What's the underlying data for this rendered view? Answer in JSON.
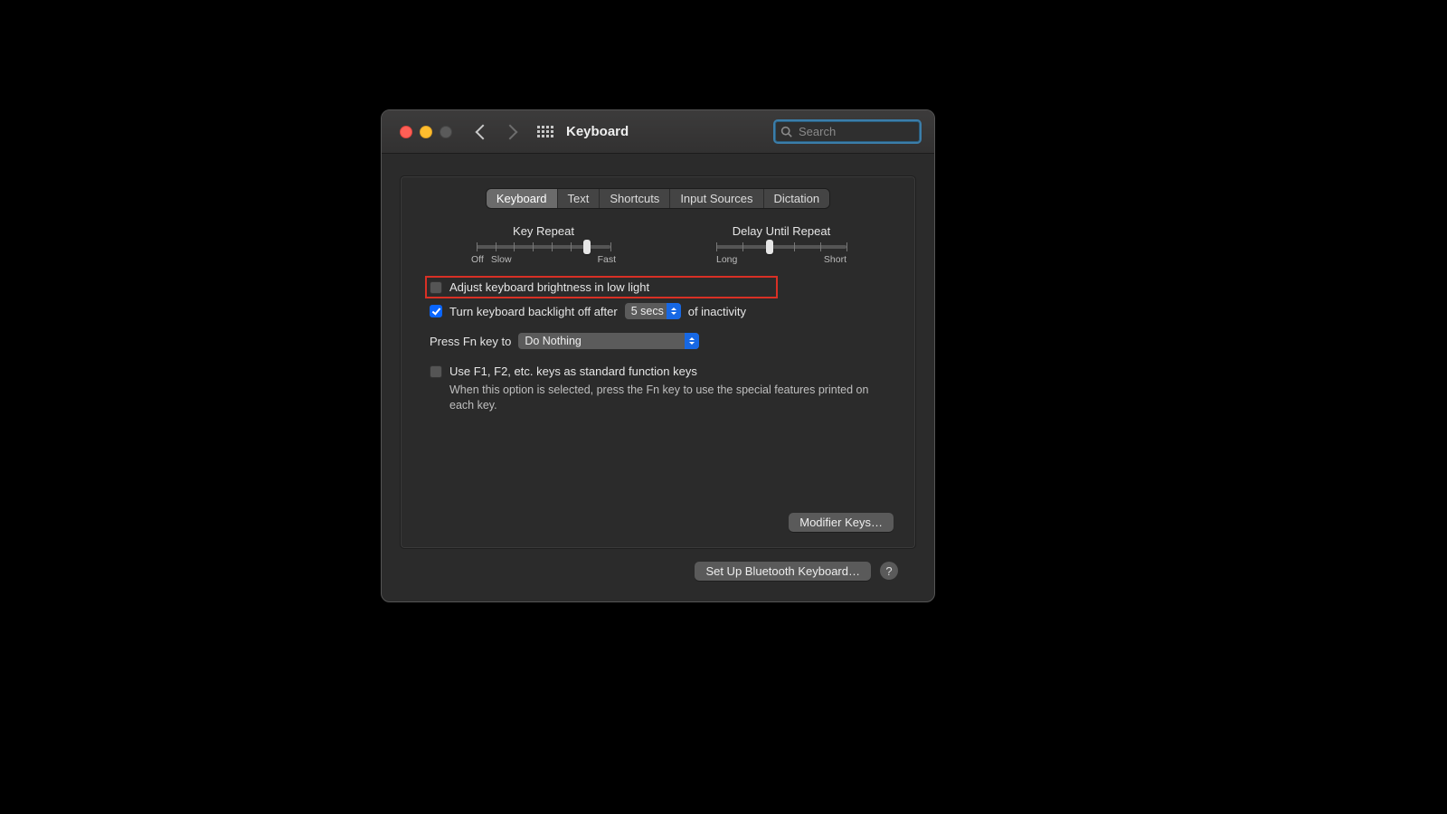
{
  "window": {
    "title": "Keyboard"
  },
  "search": {
    "placeholder": "Search"
  },
  "tabs": [
    {
      "label": "Keyboard",
      "active": true
    },
    {
      "label": "Text"
    },
    {
      "label": "Shortcuts"
    },
    {
      "label": "Input Sources"
    },
    {
      "label": "Dictation"
    }
  ],
  "sliders": {
    "key_repeat": {
      "title": "Key Repeat",
      "labels": {
        "off": "Off",
        "slow": "Slow",
        "fast": "Fast"
      }
    },
    "delay": {
      "title": "Delay Until Repeat",
      "labels": {
        "long": "Long",
        "short": "Short"
      }
    }
  },
  "options": {
    "brightness_label": "Adjust keyboard brightness in low light",
    "backlight_prefix": "Turn keyboard backlight off after",
    "backlight_value": "5 secs",
    "backlight_suffix": "of inactivity",
    "fn_prefix": "Press Fn key to",
    "fn_value": "Do Nothing",
    "fkeys_label": "Use F1, F2, etc. keys as standard function keys",
    "fkeys_desc": "When this option is selected, press the Fn key to use the special features printed on each key."
  },
  "buttons": {
    "modifier": "Modifier Keys…",
    "bluetooth": "Set Up Bluetooth Keyboard…",
    "help": "?"
  }
}
